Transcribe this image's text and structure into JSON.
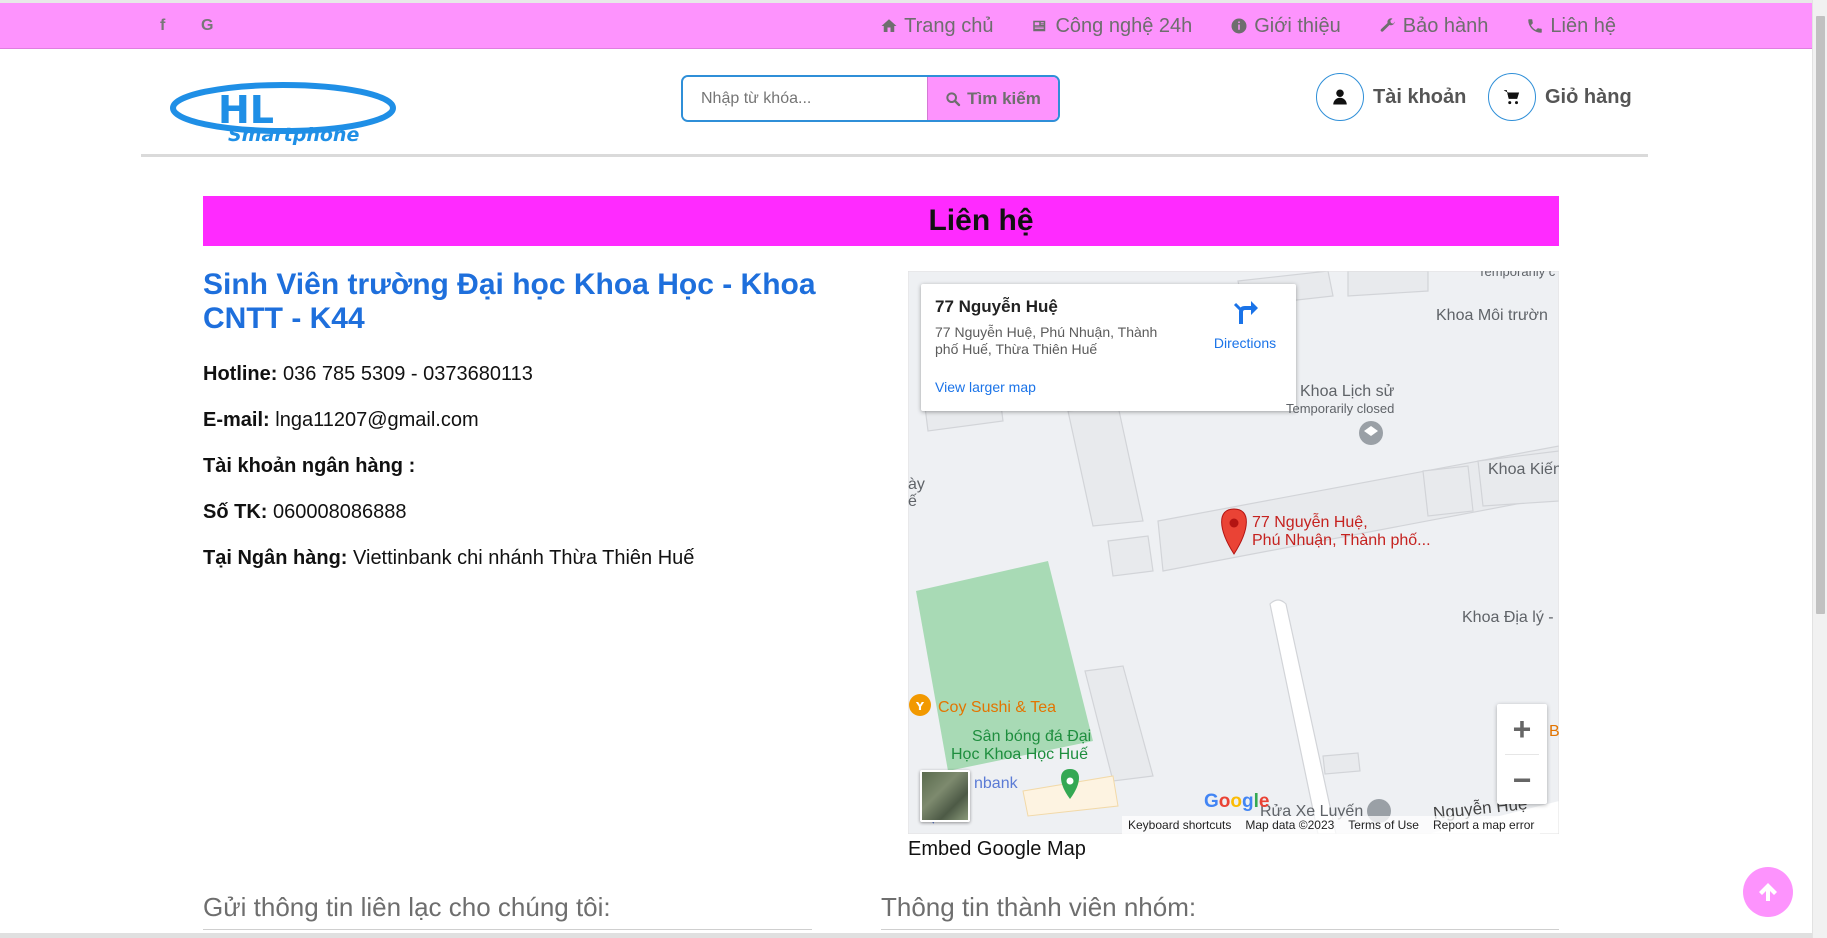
{
  "topbar": {
    "social": [
      "f",
      "G"
    ],
    "nav": [
      {
        "label": "Trang chủ",
        "icon": "home-icon"
      },
      {
        "label": "Công nghệ 24h",
        "icon": "newspaper-icon"
      },
      {
        "label": "Giới thiệu",
        "icon": "info-circle-icon"
      },
      {
        "label": "Bảo hành",
        "icon": "wrench-icon"
      },
      {
        "label": "Liên hệ",
        "icon": "phone-icon"
      }
    ]
  },
  "header": {
    "logo_text": "HL",
    "logo_sub": "Smartphone",
    "search_placeholder": "Nhập từ khóa...",
    "search_button": "Tìm kiếm",
    "account_label": "Tài khoản",
    "cart_label": "Giỏ hàng"
  },
  "page": {
    "title": "Liên hệ"
  },
  "contact": {
    "heading": "Sinh Viên trường Đại học Khoa Học - Khoa CNTT - K44",
    "hotline_label": "Hotline:",
    "hotline": "036 785 5309 - 0373680113",
    "email_label": "E-mail:",
    "email": "lnga11207@gmail.com",
    "bank_label": "Tài khoản ngân hàng :",
    "account_no_label": "Số TK:",
    "account_no": "060008086888",
    "bank_name_label": "Tại Ngân hàng:",
    "bank_name": "Viettinbank chi nhánh Thừa Thiên Huế"
  },
  "map": {
    "card_title": "77 Nguyễn Huệ",
    "card_address": "77 Nguyễn Huệ, Phú Nhuận, Thành phố Huế, Thừa Thiên Huế",
    "directions": "Directions",
    "view_larger": "View larger map",
    "labels": {
      "temp_top": "Temporarily c",
      "khoa_moi_truong": "Khoa Môi trườn",
      "khoa_lich_su": "Khoa Lịch sử",
      "temp_closed": "Temporarily closed",
      "khoa_kien": "Khoa Kiến",
      "pin_line1": "77 Nguyễn Huệ,",
      "pin_line2": "Phú Nhuận, Thành phố...",
      "khoa_dia_ly": "Khoa Địa lý -",
      "coy_sushi": "Coy Sushi & Tea",
      "san_bong1": "Sân bóng đá Đại",
      "san_bong2": "Học Khoa Học Huế",
      "bank": "nbank",
      "rua_xe": "Rửa Xe Luyến",
      "nguyen_hue": "Nguyễn Huệ",
      "edge_left1": "ày",
      "edge_left2": "ế",
      "edge_right_b": "B"
    },
    "google": "Google",
    "footer": [
      "Keyboard shortcuts",
      "Map data ©2023",
      "Terms of Use",
      "Report a map error"
    ],
    "zoom_in": "+",
    "zoom_out": "−"
  },
  "embed_caption": "Embed Google Map",
  "sections": {
    "send_info": "Gửi thông tin liên lạc cho chúng tôi:",
    "members": "Thông tin thành viên nhóm:"
  },
  "colors": {
    "topbar": "#fd93fd",
    "title_bar": "#ff2aff",
    "heading_blue": "#1e6fdc"
  }
}
